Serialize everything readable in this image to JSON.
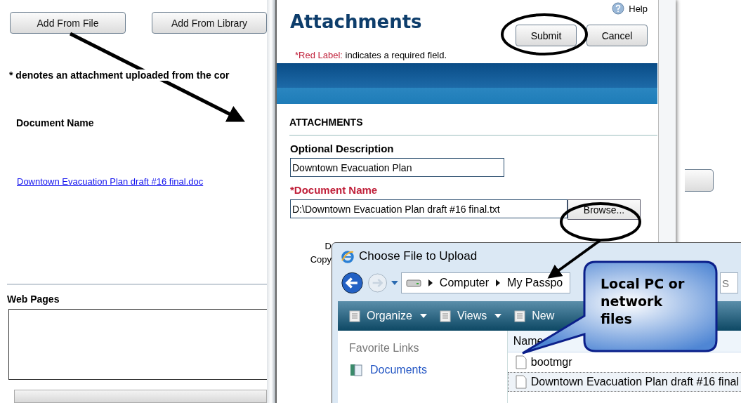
{
  "background_page": {
    "buttons": [
      "Add From File",
      "Add From Library"
    ],
    "note": "* denotes an attachment uploaded from the cor",
    "column_header": "Document Name",
    "document_link": "Downtown Evacuation Plan draft #16 final.doc",
    "section_title": "Web Pages"
  },
  "attachments_window": {
    "help": "Help",
    "title": "Attachments",
    "buttons": [
      "Submit",
      "Cancel"
    ],
    "required_note": {
      "marker": "*Red Label:",
      "text": "indicates a required field."
    },
    "section": "ATTACHMENTS",
    "fields": [
      {
        "label": "Optional Description",
        "required": false,
        "value": "Downtown Evacuation Plan"
      },
      {
        "label": "*Document Name",
        "required": true,
        "value": "D:\\Downtown Evacuation Plan draft #16 final.txt",
        "button": "Browse..."
      }
    ],
    "footer_fragments": [
      "D",
      "Copy"
    ]
  },
  "file_dialog": {
    "title": "Choose File to Upload",
    "breadcrumb": [
      "Computer",
      "My Passpo"
    ],
    "search_placeholder": "S",
    "toolbar": [
      {
        "label": "Organize",
        "dropdown": true
      },
      {
        "label": "Views",
        "dropdown": true
      },
      {
        "label": "New",
        "dropdown": false
      }
    ],
    "favorite_links_title": "Favorite Links",
    "favorite_links": [
      "Documents"
    ],
    "name_column": "Name",
    "files": [
      {
        "name": "bootmgr",
        "selected": false
      },
      {
        "name": "Downtown Evacuation Plan draft #16 final",
        "selected": true
      }
    ]
  },
  "annotation": {
    "callout": "Local PC or network files"
  }
}
